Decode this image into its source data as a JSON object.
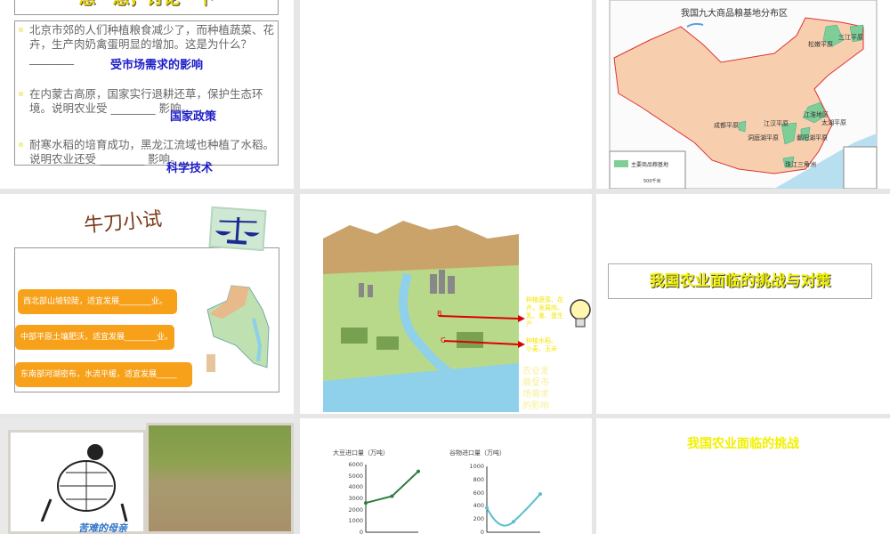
{
  "slides": [
    {
      "title": "想一想，讨论一下",
      "bullets": [
        {
          "text": "北京市郊的人们种植粮食减少了，而种植蔬菜、花卉，生产肉奶禽蛋明显的增加。这是为什么？ ________",
          "answer": "受市场需求的影响"
        },
        {
          "text": "在内蒙古高原，国家实行退耕还草，保护生态环境。说明农业受 ________ 影响。",
          "answer": "国家政策"
        },
        {
          "text": "耐寒水稻的培育成功，黑龙江流域也种植了水稻。说明农业还受 ________ 影响。",
          "answer": "科学技术"
        }
      ]
    },
    {
      "title": ""
    },
    {
      "map_title": "我国九大商品粮基地分布区",
      "legend": "主要商品粮基地",
      "scale": "500千米",
      "regions": [
        "三江平原",
        "松嫩平原",
        "江淮地区",
        "太湖平原",
        "成都平原",
        "江汉平原",
        "洞庭湖平原",
        "鄱阳湖平原",
        "珠江三角洲"
      ]
    },
    {
      "title": "牛刀小试",
      "items": [
        "西北部山坡较陡，适宜发展________业。",
        "中部平原土壤肥沃，适宜发展________业。",
        "东南部河湖密布，水流平缓，适宜发展_____业。"
      ]
    },
    {
      "label_a": "种植蔬菜、花卉，发展肉、乳、禽、蛋生产",
      "label_c": "种植水稻、小麦、玉米",
      "note": "农业发展受市场需求的影响",
      "marker_b": "B",
      "marker_c": "C"
    },
    {
      "title": "我国农业面临的挑战与对策"
    },
    {
      "caption": "苦难的母亲"
    },
    {
      "charts": [
        {
          "title": "大豆进口量（万吨）",
          "ticks": [
            "6000",
            "5000",
            "4000",
            "3000",
            "2000",
            "1000",
            "0"
          ],
          "ylim": [
            0,
            6000
          ],
          "values": [
            2600,
            3200,
            5400
          ],
          "color": "#2e7d3e"
        },
        {
          "title": "谷物进口量（万吨）",
          "ticks": [
            "1000",
            "800",
            "600",
            "400",
            "200",
            "0"
          ],
          "ylim": [
            0,
            1000
          ],
          "values": [
            370,
            160,
            580
          ],
          "color": "#5bbfcf"
        }
      ]
    },
    {
      "title": "我国农业面临的挑战"
    }
  ]
}
